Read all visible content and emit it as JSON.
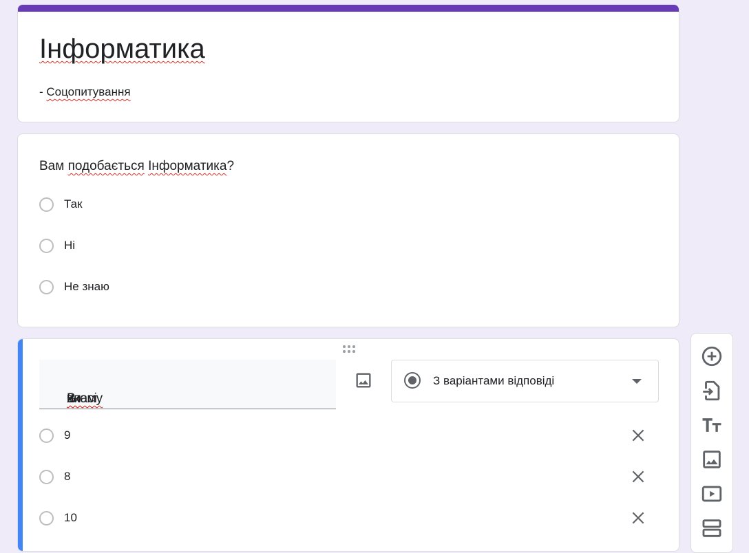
{
  "form": {
    "title": "Інформатика",
    "description_prefix": "- ",
    "description": "Соцопитування"
  },
  "question1": {
    "title_parts": [
      "Вам ",
      "подобається",
      " ",
      "Інформатика",
      "?"
    ],
    "options": [
      "Так",
      "Ні",
      "Не знаю"
    ]
  },
  "question2": {
    "title_parts": [
      "В ",
      "якому",
      " ",
      "ви",
      " ",
      "класі",
      "?"
    ],
    "type_label": "З варіантами відповіді",
    "options": [
      "9",
      "8",
      "10"
    ]
  },
  "colors": {
    "accent": "#673ab7",
    "active_bar": "#4285f4",
    "background": "#efebf8"
  },
  "toolbar": {
    "icons": [
      "add-question-icon",
      "import-questions-icon",
      "add-title-icon",
      "add-image-icon",
      "add-video-icon",
      "add-section-icon"
    ]
  }
}
